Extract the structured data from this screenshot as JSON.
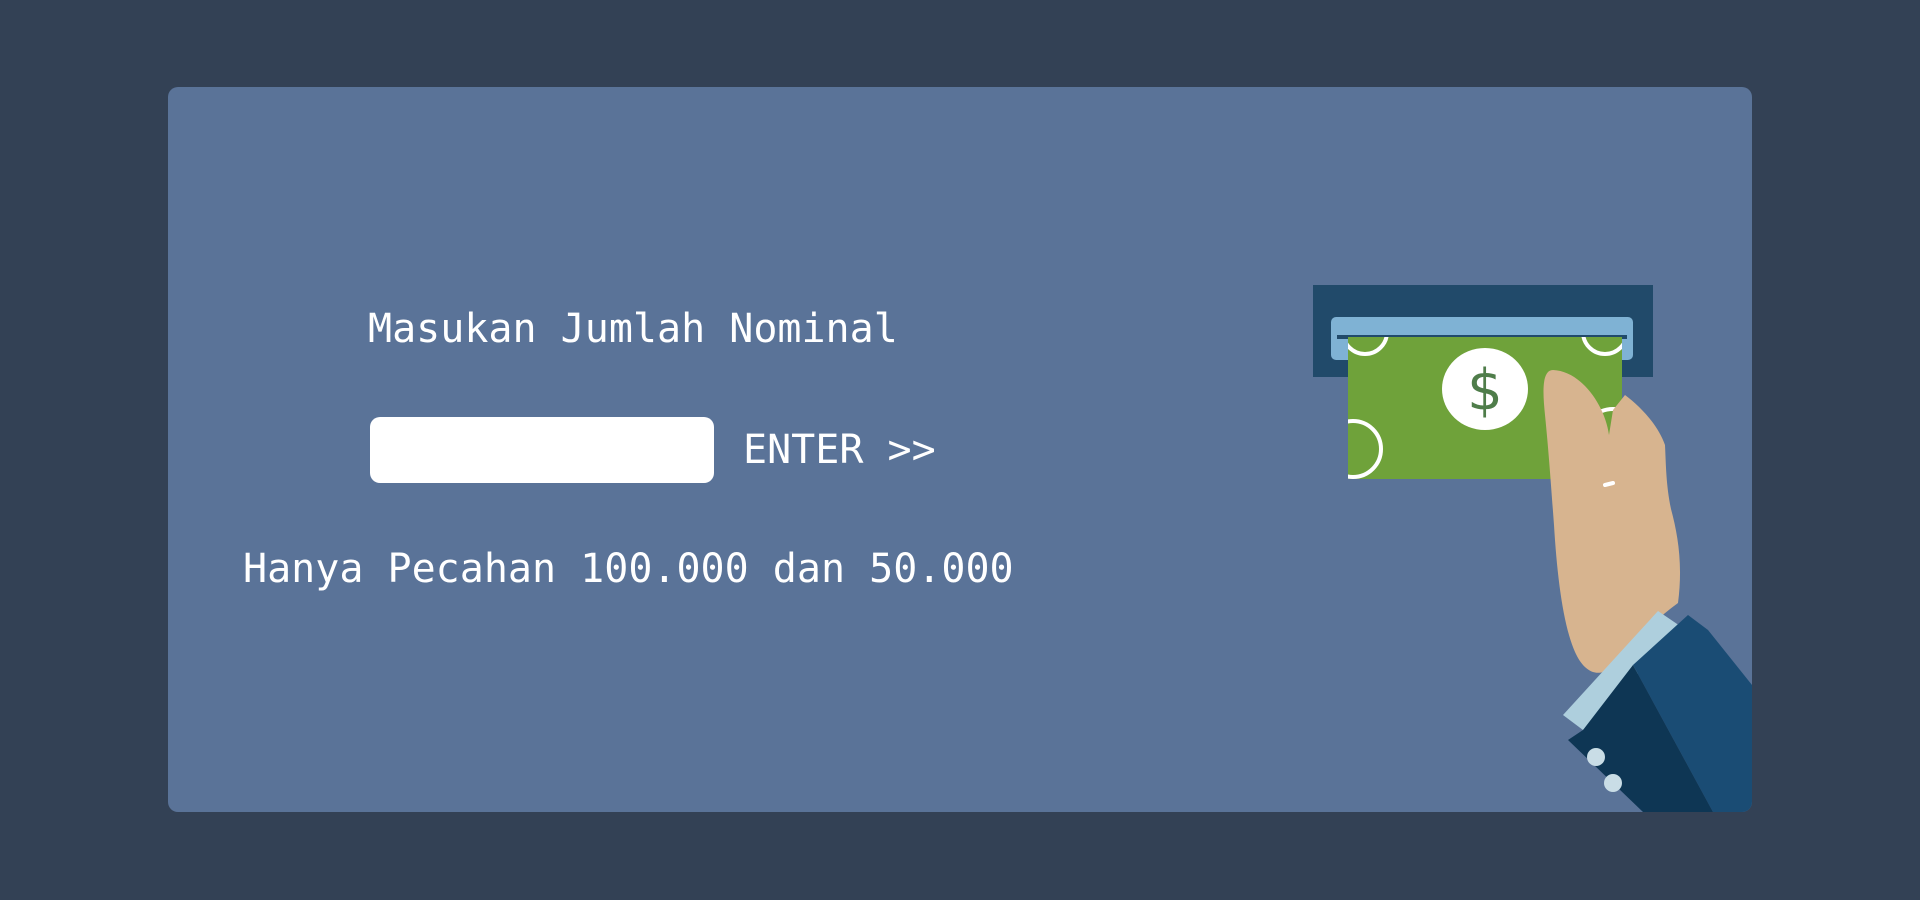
{
  "atm": {
    "prompt": "Masukan Jumlah Nominal",
    "amount_value": "",
    "enter_label": "ENTER >>",
    "note": "Hanya Pecahan 100.000 dan 50.000"
  },
  "illustration": {
    "icon": "hand-inserting-cash-icon",
    "bill_symbol": "$"
  },
  "colors": {
    "page_background": "#334155",
    "card_background": "#5a7398",
    "text": "#ffffff",
    "bill_green": "#6fa23a",
    "slot_dark": "#214a6a",
    "slot_light": "#7fb2d4",
    "skin": "#d7b48f",
    "sleeve": "#1a4c74"
  }
}
